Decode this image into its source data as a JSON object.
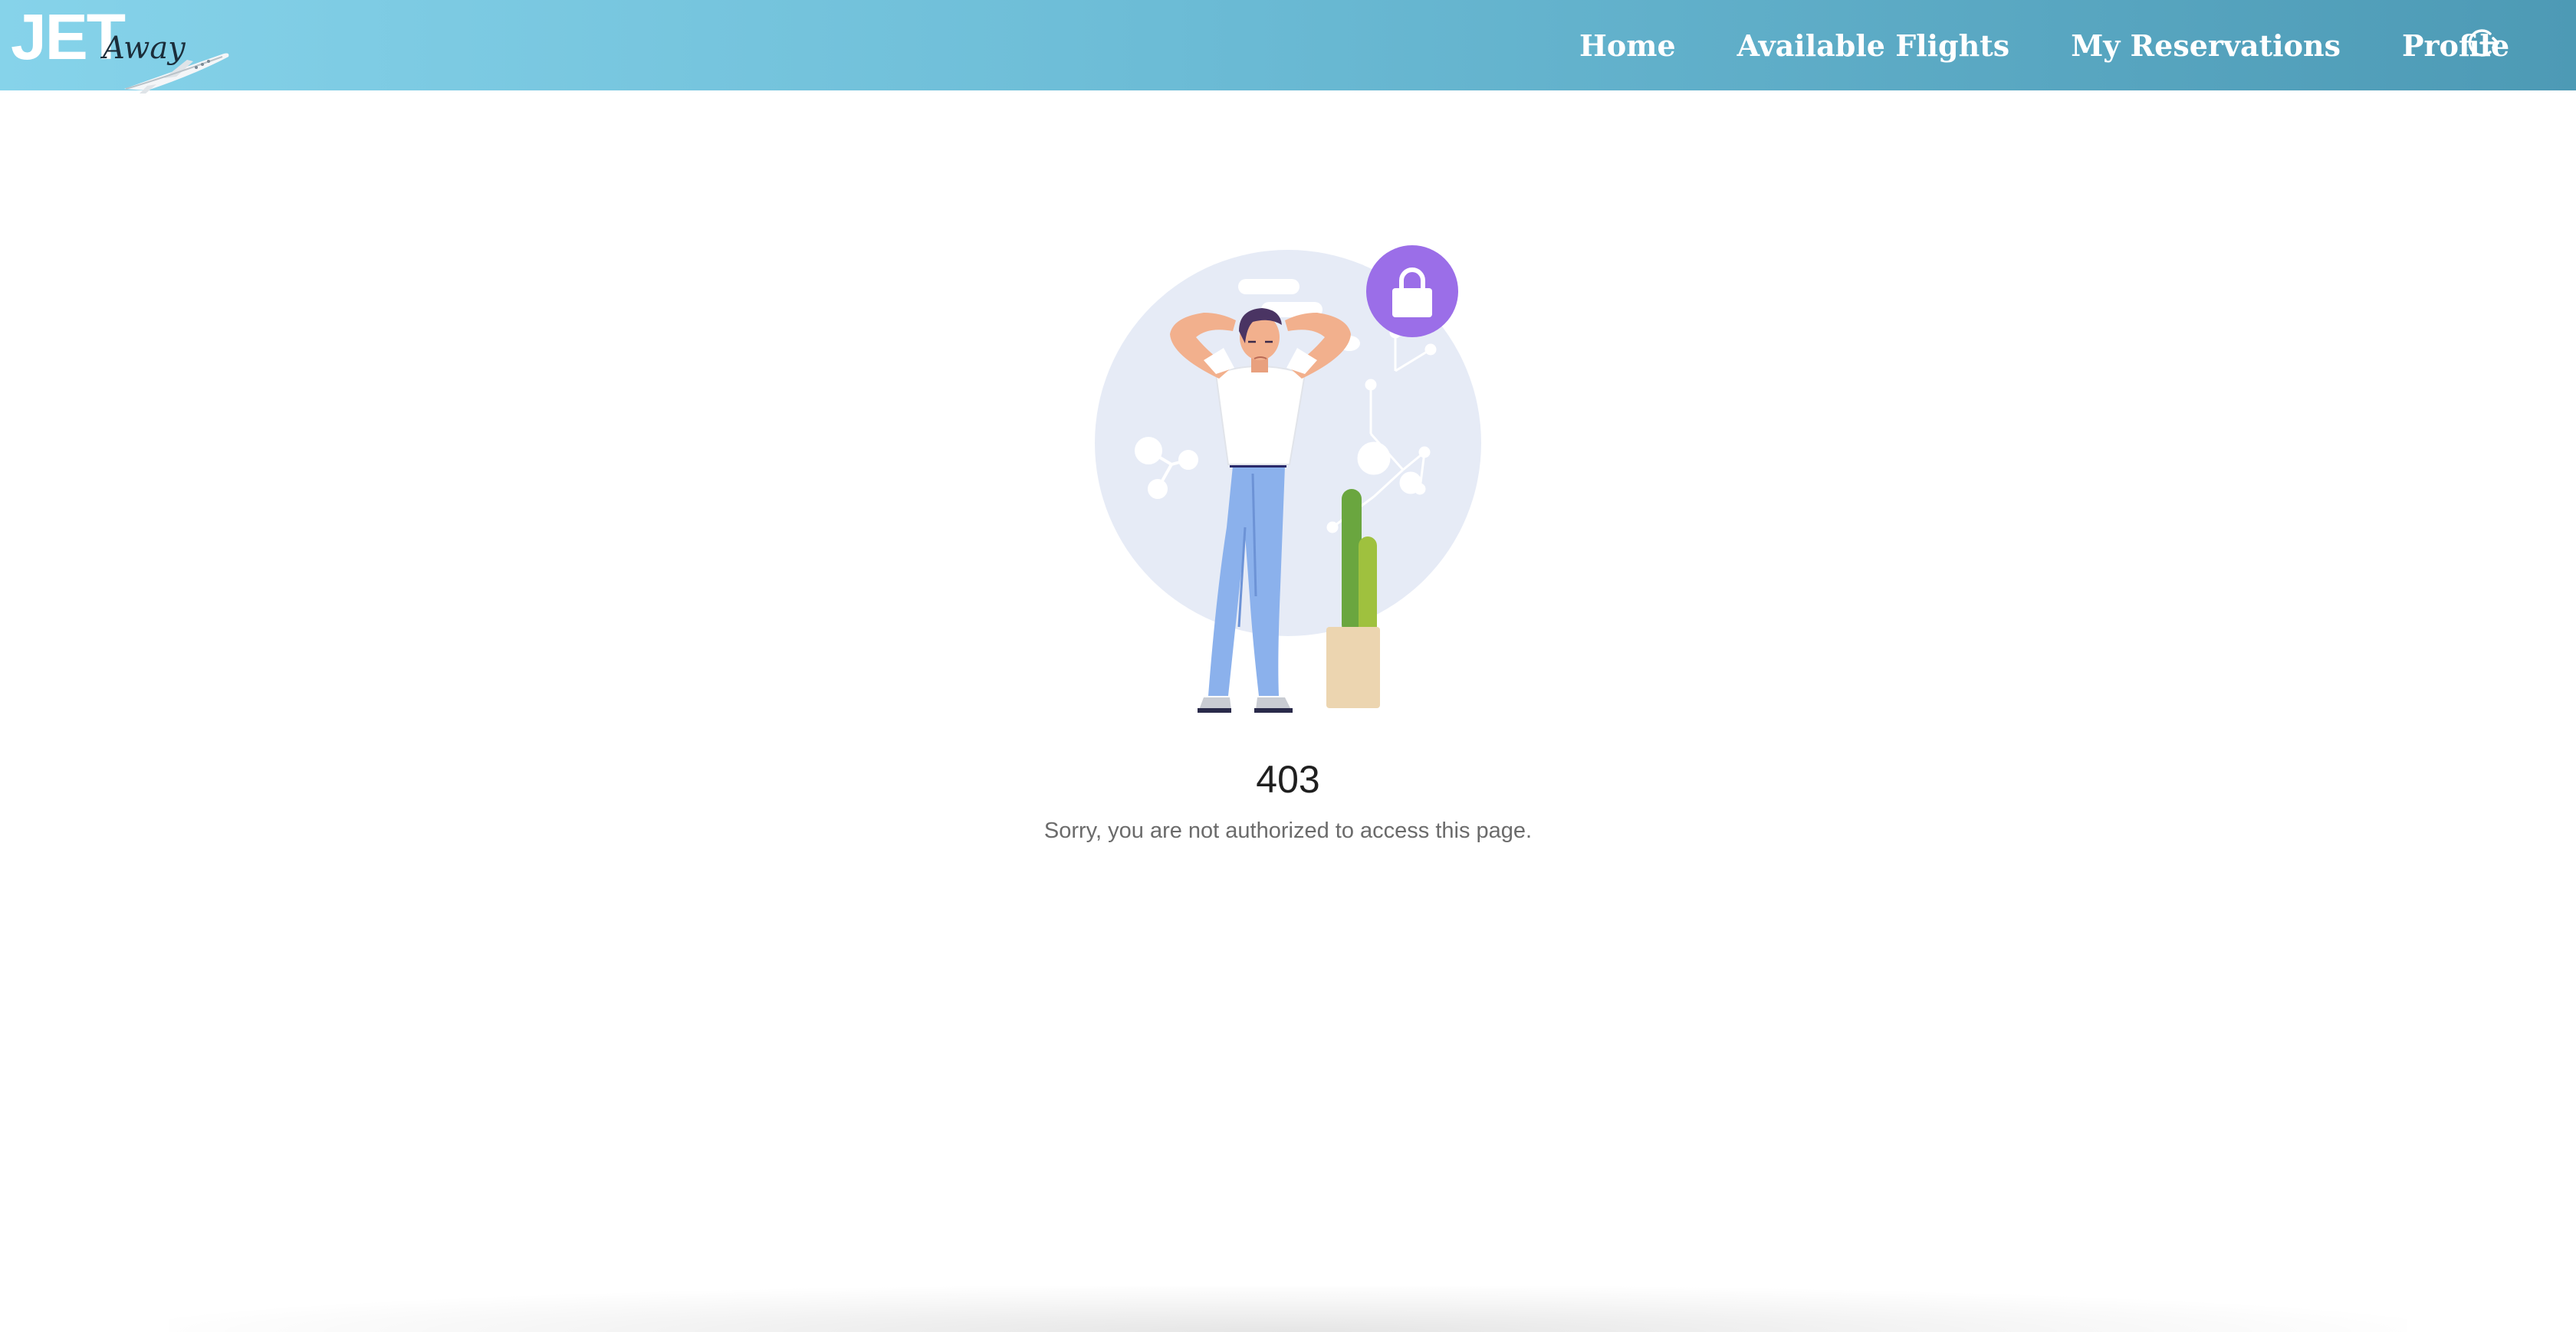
{
  "brand": {
    "logo_main": "JET",
    "logo_script": "Away"
  },
  "nav": {
    "items": [
      {
        "label": "Home",
        "name": "nav-home"
      },
      {
        "label": "Available Flights",
        "name": "nav-available-flights"
      },
      {
        "label": "My Reservations",
        "name": "nav-my-reservations"
      },
      {
        "label": "Profile",
        "name": "nav-profile"
      }
    ],
    "logout_icon": "logout-icon"
  },
  "result": {
    "status": "403",
    "message": "Sorry, you are not authorized to access this page.",
    "icon": "lock-icon"
  },
  "colors": {
    "header_gradient_start": "#86d3ea",
    "header_gradient_end": "#4d9ab5",
    "lock_badge": "#9b6ee8",
    "illustration_circle": "#e6ebf6"
  }
}
